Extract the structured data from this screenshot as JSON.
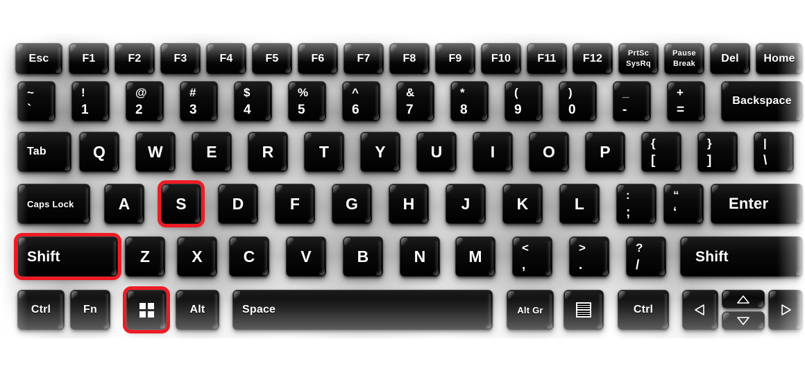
{
  "scene": {
    "title": "Computer keyboard layout with Shift + Windows + S shortcut highlighted",
    "background_color": "#ffffff",
    "key_color": "#000000",
    "key_text_color": "#ffffff",
    "highlight_color": "#ee1b24"
  },
  "rows": {
    "function_row": [
      {
        "label": "Esc"
      },
      {
        "label": "F1"
      },
      {
        "label": "F2"
      },
      {
        "label": "F3"
      },
      {
        "label": "F4"
      },
      {
        "label": "F5"
      },
      {
        "label": "F6"
      },
      {
        "label": "F7"
      },
      {
        "label": "F8"
      },
      {
        "label": "F9"
      },
      {
        "label": "F10"
      },
      {
        "label": "F11"
      },
      {
        "label": "F12"
      },
      {
        "label_top": "PrtSc",
        "label_bottom": "SysRq"
      },
      {
        "label_top": "Pause",
        "label_bottom": "Break"
      },
      {
        "label": "Del"
      },
      {
        "label": "Home"
      }
    ],
    "number_row": [
      {
        "top": "~",
        "bottom": "`"
      },
      {
        "top": "!",
        "bottom": "1"
      },
      {
        "top": "@",
        "bottom": "2"
      },
      {
        "top": "#",
        "bottom": "3"
      },
      {
        "top": "$",
        "bottom": "4"
      },
      {
        "top": "%",
        "bottom": "5"
      },
      {
        "top": "^",
        "bottom": "6"
      },
      {
        "top": "&",
        "bottom": "7"
      },
      {
        "top": "*",
        "bottom": "8"
      },
      {
        "top": "(",
        "bottom": "9"
      },
      {
        "top": ")",
        "bottom": "0"
      },
      {
        "top": "_",
        "bottom": "-"
      },
      {
        "top": "+",
        "bottom": "="
      },
      {
        "label": "Backspace"
      }
    ],
    "top_row": [
      {
        "label": "Tab"
      },
      {
        "label": "Q"
      },
      {
        "label": "W"
      },
      {
        "label": "E"
      },
      {
        "label": "R"
      },
      {
        "label": "T"
      },
      {
        "label": "Y"
      },
      {
        "label": "U"
      },
      {
        "label": "I"
      },
      {
        "label": "O"
      },
      {
        "label": "P"
      },
      {
        "top": "{",
        "bottom": "["
      },
      {
        "top": "}",
        "bottom": "]"
      },
      {
        "top": "|",
        "bottom": "\\"
      }
    ],
    "home_row": [
      {
        "label": "Caps Lock"
      },
      {
        "label": "A"
      },
      {
        "label": "S"
      },
      {
        "label": "D"
      },
      {
        "label": "F"
      },
      {
        "label": "G"
      },
      {
        "label": "H"
      },
      {
        "label": "J"
      },
      {
        "label": "K"
      },
      {
        "label": "L"
      },
      {
        "top": ":",
        "bottom": ";"
      },
      {
        "top": "“",
        "bottom": "‘"
      },
      {
        "label": "Enter"
      }
    ],
    "bottom_letter_row": [
      {
        "label": "Shift"
      },
      {
        "label": "Z"
      },
      {
        "label": "X"
      },
      {
        "label": "C"
      },
      {
        "label": "V"
      },
      {
        "label": "B"
      },
      {
        "label": "N"
      },
      {
        "label": "M"
      },
      {
        "top": "<",
        "bottom": ","
      },
      {
        "top": ">",
        "bottom": "."
      },
      {
        "top": "?",
        "bottom": "/"
      },
      {
        "label": "Shift"
      }
    ],
    "modifier_row": [
      {
        "label": "Ctrl"
      },
      {
        "label": "Fn"
      },
      {
        "label": "",
        "icon": "windows-icon"
      },
      {
        "label": "Alt"
      },
      {
        "label": "Space"
      },
      {
        "label": "Alt Gr"
      },
      {
        "label": "",
        "icon": "menu-icon"
      },
      {
        "label": "Ctrl"
      },
      {
        "label": "",
        "icon": "arrow-left-icon"
      },
      {
        "label": "",
        "icon": "arrow-up-icon"
      },
      {
        "label": "",
        "icon": "arrow-down-icon"
      },
      {
        "label": "",
        "icon": "arrow-right-icon"
      }
    ]
  },
  "highlighted_keys": [
    "S",
    "Shift",
    "Windows"
  ]
}
